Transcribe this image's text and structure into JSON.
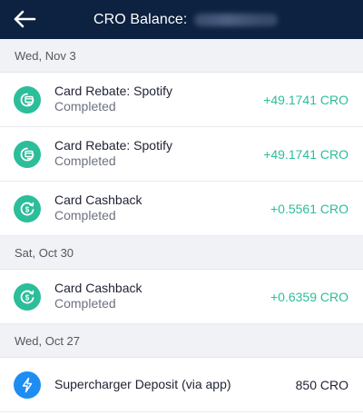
{
  "header": {
    "title": "CRO Balance:",
    "back_icon": "arrow-left-icon"
  },
  "colors": {
    "header_bg": "#0d2140",
    "positive": "#2cbd9a",
    "icon_green": "#2cbd9a",
    "icon_blue": "#1d8df2"
  },
  "groups": [
    {
      "date": "Wed, Nov 3",
      "transactions": [
        {
          "icon": "card-rebate-icon",
          "name": "Card Rebate: Spotify",
          "status": "Completed",
          "amount": "+49.1741 CRO"
        },
        {
          "icon": "card-rebate-icon",
          "name": "Card Rebate: Spotify",
          "status": "Completed",
          "amount": "+49.1741 CRO"
        },
        {
          "icon": "cashback-icon",
          "name": "Card Cashback",
          "status": "Completed",
          "amount": "+0.5561 CRO"
        }
      ]
    },
    {
      "date": "Sat, Oct 30",
      "transactions": [
        {
          "icon": "cashback-icon",
          "name": "Card Cashback",
          "status": "Completed",
          "amount": "+0.6359 CRO"
        }
      ]
    },
    {
      "date": "Wed, Oct 27",
      "transactions": [
        {
          "icon": "lightning-icon",
          "name": "Supercharger Deposit (via app)",
          "status": "",
          "amount": "850 CRO"
        }
      ]
    }
  ]
}
